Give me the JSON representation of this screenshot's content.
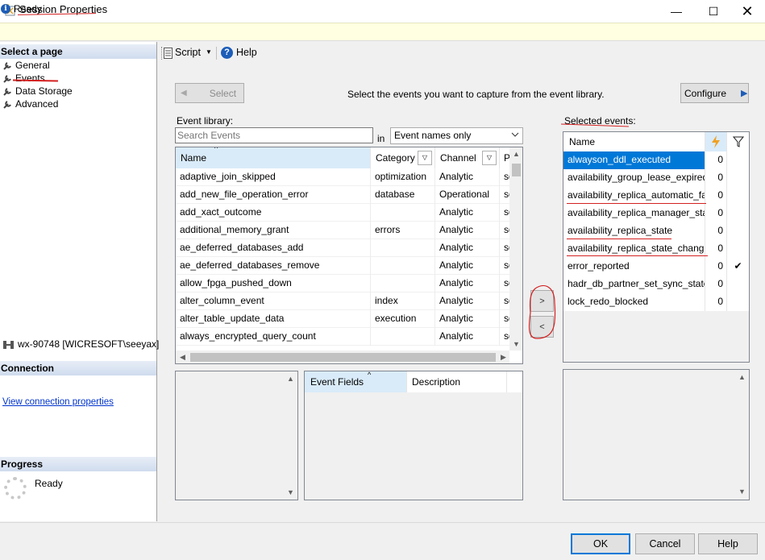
{
  "window": {
    "title": "Session Properties",
    "minimize_glyph": "—",
    "maximize_glyph": "☐",
    "close_glyph": "✕"
  },
  "status": {
    "icon": "i",
    "text": "Ready"
  },
  "sidebar": {
    "header": "Select a page",
    "items": [
      {
        "label": "General",
        "icon": "wrench-icon"
      },
      {
        "label": "Events",
        "icon": "wrench-icon"
      },
      {
        "label": "Data Storage",
        "icon": "wrench-icon"
      },
      {
        "label": "Advanced",
        "icon": "wrench-icon"
      }
    ],
    "connection_header": "Connection",
    "connection_text": "wx-90748 [WICRESOFT\\seeyax]",
    "view_connection_link": "View connection properties",
    "progress_header": "Progress",
    "progress_text": "Ready"
  },
  "toolbar": {
    "script_label": "Script",
    "script_arrow": "▼",
    "help_icon": "?",
    "help_label": "Help"
  },
  "main": {
    "select_button": "Select",
    "select_arrow": "◀",
    "instruction": "Select the events you want to capture from the event library.",
    "configure_button": "Configure",
    "configure_arrow": "▶",
    "event_library_label": "Event library:",
    "search_placeholder": "Search Events",
    "in_label": "in",
    "filter_value": "Event names only",
    "columns": {
      "name": "Name",
      "category": "Category",
      "channel": "Channel",
      "package": "P",
      "sort_glyph": "^",
      "dd_glyph": "▽"
    },
    "events": [
      {
        "name": "adaptive_join_skipped",
        "category": "optimization",
        "channel": "Analytic",
        "package": "sq"
      },
      {
        "name": "add_new_file_operation_error",
        "category": "database",
        "channel": "Operational",
        "package": "sq"
      },
      {
        "name": "add_xact_outcome",
        "category": "",
        "channel": "Analytic",
        "package": "sq"
      },
      {
        "name": "additional_memory_grant",
        "category": "errors",
        "channel": "Analytic",
        "package": "sq"
      },
      {
        "name": "ae_deferred_databases_add",
        "category": "",
        "channel": "Analytic",
        "package": "sq"
      },
      {
        "name": "ae_deferred_databases_remove",
        "category": "",
        "channel": "Analytic",
        "package": "sq"
      },
      {
        "name": "allow_fpga_pushed_down",
        "category": "",
        "channel": "Analytic",
        "package": "sq"
      },
      {
        "name": "alter_column_event",
        "category": "index",
        "channel": "Analytic",
        "package": "sq"
      },
      {
        "name": "alter_table_update_data",
        "category": "execution",
        "channel": "Analytic",
        "package": "sq"
      },
      {
        "name": "always_encrypted_query_count",
        "category": "",
        "channel": "Analytic",
        "package": "sq"
      }
    ],
    "fields_columns": {
      "event_fields": "Event Fields",
      "description": "Description",
      "sort_glyph": "^"
    },
    "add_glyph": ">",
    "remove_glyph": "<",
    "selected_label": "Selected events:",
    "selected_columns": {
      "name": "Name",
      "actions_icon": "lightning-icon",
      "filter_icon": "filter-icon"
    },
    "selected_events": [
      {
        "name": "alwayson_ddl_executed",
        "count": "0",
        "check": ""
      },
      {
        "name": "availability_group_lease_expired",
        "count": "0",
        "check": ""
      },
      {
        "name": "availability_replica_automatic_failo...",
        "count": "0",
        "check": ""
      },
      {
        "name": "availability_replica_manager_state...",
        "count": "0",
        "check": ""
      },
      {
        "name": "availability_replica_state",
        "count": "0",
        "check": ""
      },
      {
        "name": "availability_replica_state_change",
        "count": "0",
        "check": ""
      },
      {
        "name": "error_reported",
        "count": "0",
        "check": "✔"
      },
      {
        "name": "hadr_db_partner_set_sync_state",
        "count": "0",
        "check": ""
      },
      {
        "name": "lock_redo_blocked",
        "count": "0",
        "check": ""
      }
    ]
  },
  "buttons": {
    "ok": "OK",
    "cancel": "Cancel",
    "help": "Help"
  },
  "colors": {
    "selection": "#0078d7",
    "annotation_red": "#d42020",
    "status_bg": "#ffffe1"
  }
}
